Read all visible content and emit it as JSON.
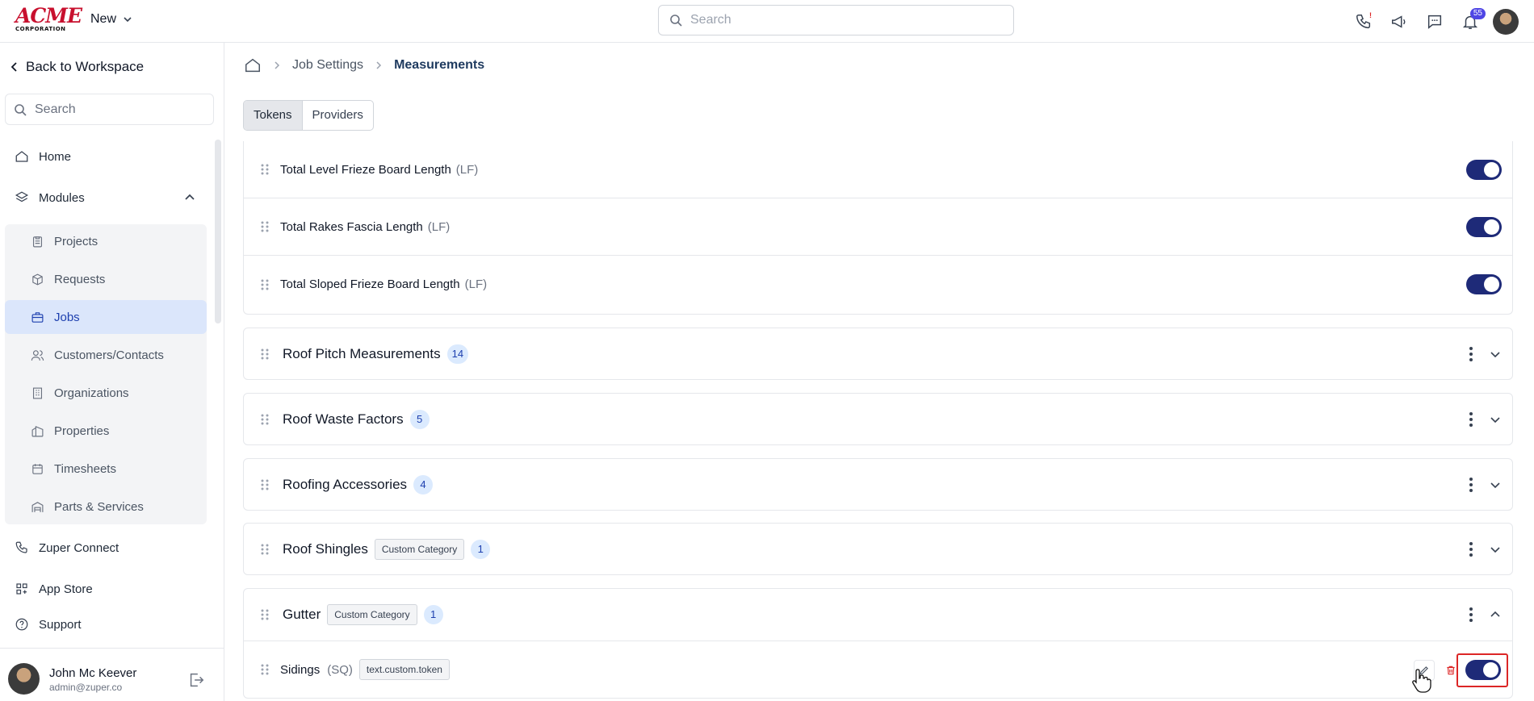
{
  "header": {
    "logo_line1": "ACME",
    "logo_line2": "CORPORATION",
    "new_label": "New",
    "search_placeholder": "Search",
    "notification_count": "55",
    "phone_alert": "!"
  },
  "sidebar": {
    "back_label": "Back to Workspace",
    "search_placeholder": "Search",
    "home_label": "Home",
    "modules_label": "Modules",
    "module_items": [
      "Projects",
      "Requests",
      "Jobs",
      "Customers/Contacts",
      "Organizations",
      "Properties",
      "Timesheets",
      "Parts & Services"
    ],
    "active_module": "Jobs",
    "zuper_connect_label": "Zuper Connect",
    "app_store_label": "App Store",
    "support_label": "Support",
    "user": {
      "name": "John Mc Keever",
      "email": "admin@zuper.co"
    }
  },
  "breadcrumb": {
    "parent": "Job Settings",
    "current": "Measurements"
  },
  "tabs": {
    "tokens": "Tokens",
    "providers": "Providers",
    "active": "Tokens"
  },
  "token_rows": [
    {
      "name": "Total Level Frieze Board Length",
      "unit": "(LF)",
      "enabled": true
    },
    {
      "name": "Total Rakes Fascia Length",
      "unit": "(LF)",
      "enabled": true
    },
    {
      "name": "Total Sloped Frieze Board Length",
      "unit": "(LF)",
      "enabled": true
    }
  ],
  "categories": [
    {
      "name": "Roof Pitch Measurements",
      "count": "14"
    },
    {
      "name": "Roof Waste Factors",
      "count": "5"
    },
    {
      "name": "Roofing Accessories",
      "count": "4"
    },
    {
      "name": "Roof Shingles",
      "tag": "Custom Category",
      "count": "1"
    }
  ],
  "gutter": {
    "name": "Gutter",
    "tag": "Custom Category",
    "count": "1",
    "item": {
      "name": "Sidings",
      "unit": "(SQ)",
      "token": "text.custom.token",
      "enabled": true
    }
  },
  "colors": {
    "toggle_on": "#1e2a78",
    "accent": "#1e40af",
    "highlight": "#dc2626"
  }
}
